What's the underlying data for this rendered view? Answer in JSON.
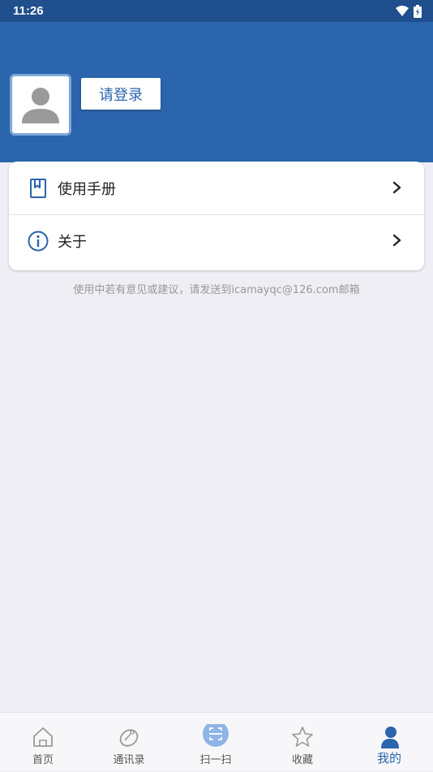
{
  "status_bar": {
    "time": "11:26"
  },
  "header": {
    "login_label": "请登录"
  },
  "menu": {
    "items": [
      {
        "label": "使用手册",
        "icon": "book-icon"
      },
      {
        "label": "关于",
        "icon": "info-icon"
      }
    ]
  },
  "feedback_text": "使用中若有意见或建议，请发送到icamayqc@126.com邮箱",
  "tabs": [
    {
      "label": "首页",
      "icon": "home-icon"
    },
    {
      "label": "通讯录",
      "icon": "contacts-icon"
    },
    {
      "label": "扫一扫",
      "icon": "scan-icon"
    },
    {
      "label": "收藏",
      "icon": "star-icon"
    },
    {
      "label": "我的",
      "icon": "person-icon",
      "active": true
    }
  ],
  "colors": {
    "accent": "#2a65ad",
    "status_bar": "#1f4f8c",
    "background": "#eeeef4"
  }
}
